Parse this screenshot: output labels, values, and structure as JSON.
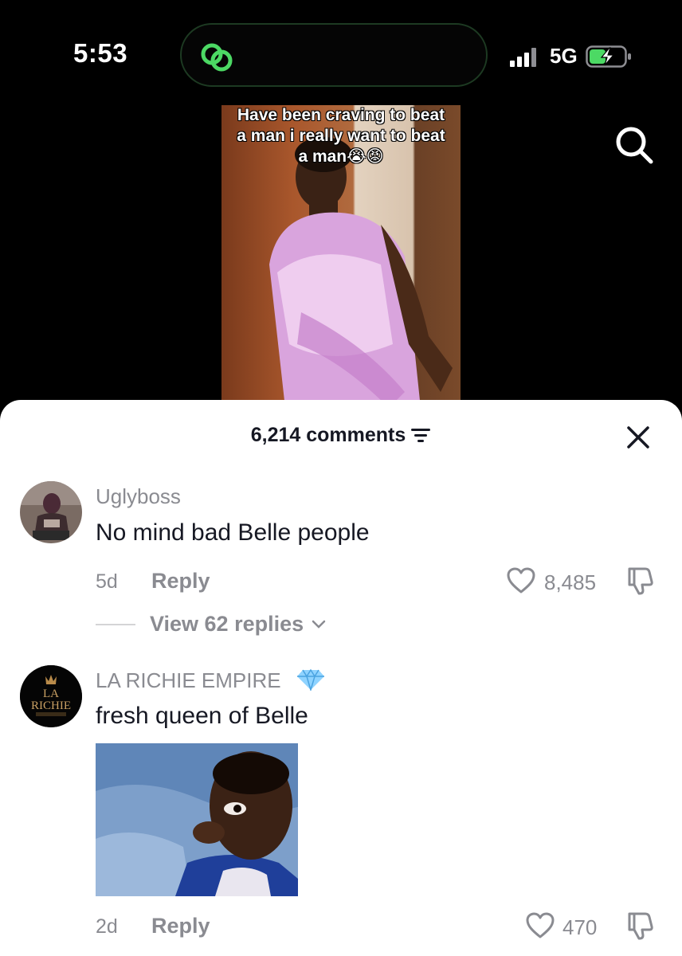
{
  "status_bar": {
    "time": "5:53",
    "network": "5G",
    "island_icon": "link-rings-icon",
    "signal_icon": "signal-bars-icon",
    "battery_icon": "battery-charging-icon"
  },
  "video": {
    "caption_lines": [
      "Have been craving to beat",
      "a man i really want to beat",
      "a man😭😡"
    ]
  },
  "header": {
    "comments_count_label": "6,214 comments",
    "filter_icon": "filter-icon",
    "close_icon": "close-icon",
    "search_icon": "search-icon"
  },
  "comments": [
    {
      "username": "Uglyboss",
      "text": "No mind bad Belle people",
      "age": "5d",
      "reply_label": "Reply",
      "likes": "8,485",
      "view_replies": "View 62 replies"
    },
    {
      "username": "LA RICHIE EMPIRE",
      "badge": "diamond-icon",
      "text": "fresh queen of Belle",
      "age": "2d",
      "reply_label": "Reply",
      "likes": "470",
      "avatar_logo_text": "RICHIE"
    }
  ],
  "colors": {
    "background": "#000000",
    "sheet": "#ffffff",
    "text_primary": "#161823",
    "text_secondary": "#8a8b91",
    "accent_green": "#4cd964",
    "diamond": "#5ab4f0"
  }
}
